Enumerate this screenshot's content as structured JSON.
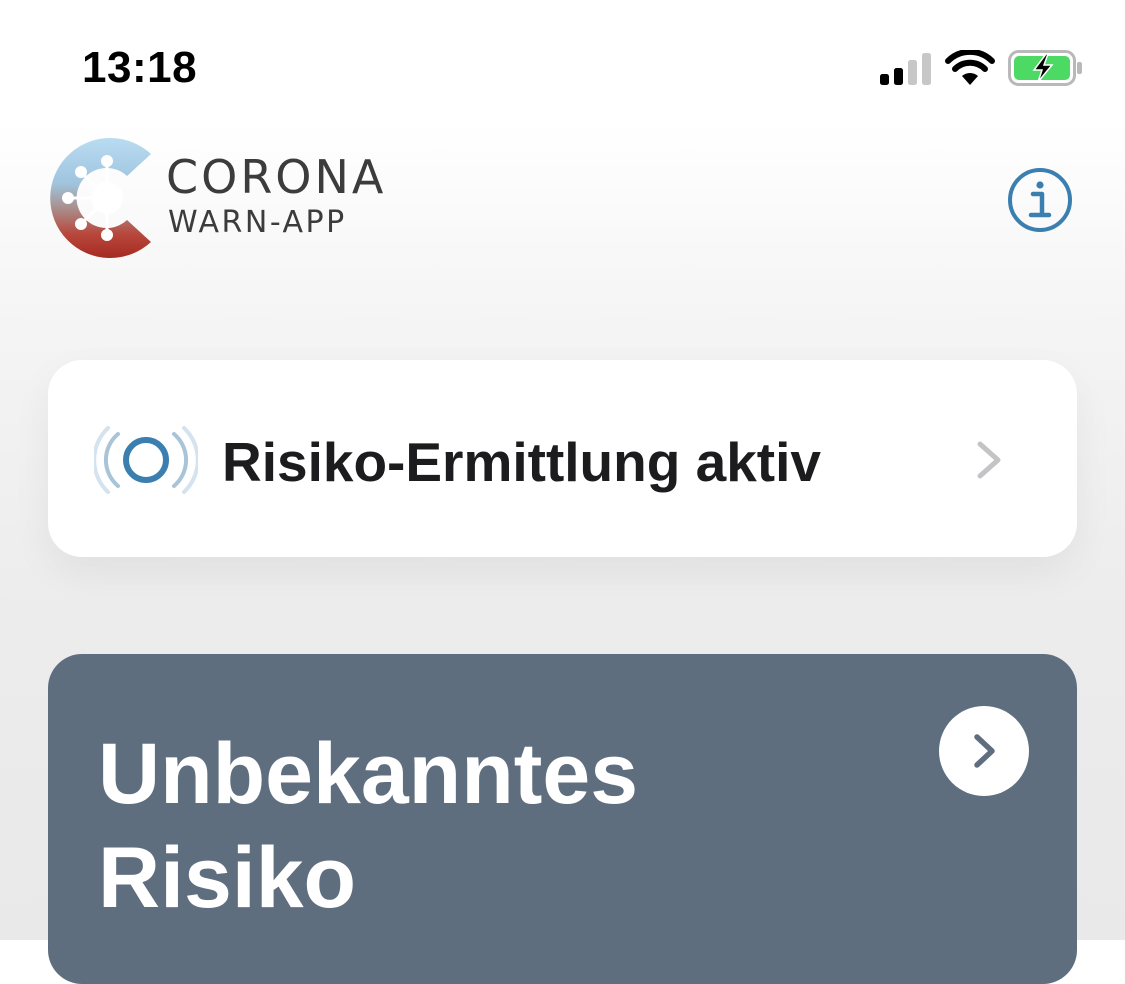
{
  "status_bar": {
    "time": "13:18",
    "icons": [
      "signal-icon",
      "wifi-icon",
      "battery-charging-icon"
    ]
  },
  "header": {
    "title_main": "CORONA",
    "title_sub": "WARN-APP",
    "logo_icon": "corona-virus-logo-icon",
    "info_icon": "info-icon"
  },
  "detection_card": {
    "label": "Risiko-Ermittlung aktiv",
    "icon": "active-tracing-icon",
    "chevron": "chevron-right-icon"
  },
  "risk_card": {
    "title_line1": "Unbekanntes",
    "title_line2": "Risiko",
    "chevron": "chevron-right-icon"
  },
  "colors": {
    "accent_blue": "#3b7fb0",
    "risk_card_bg": "#5f6e7f",
    "battery_green": "#4cd964",
    "text_dark": "#1c1c1e",
    "logo_gray": "#3c3c3c"
  }
}
